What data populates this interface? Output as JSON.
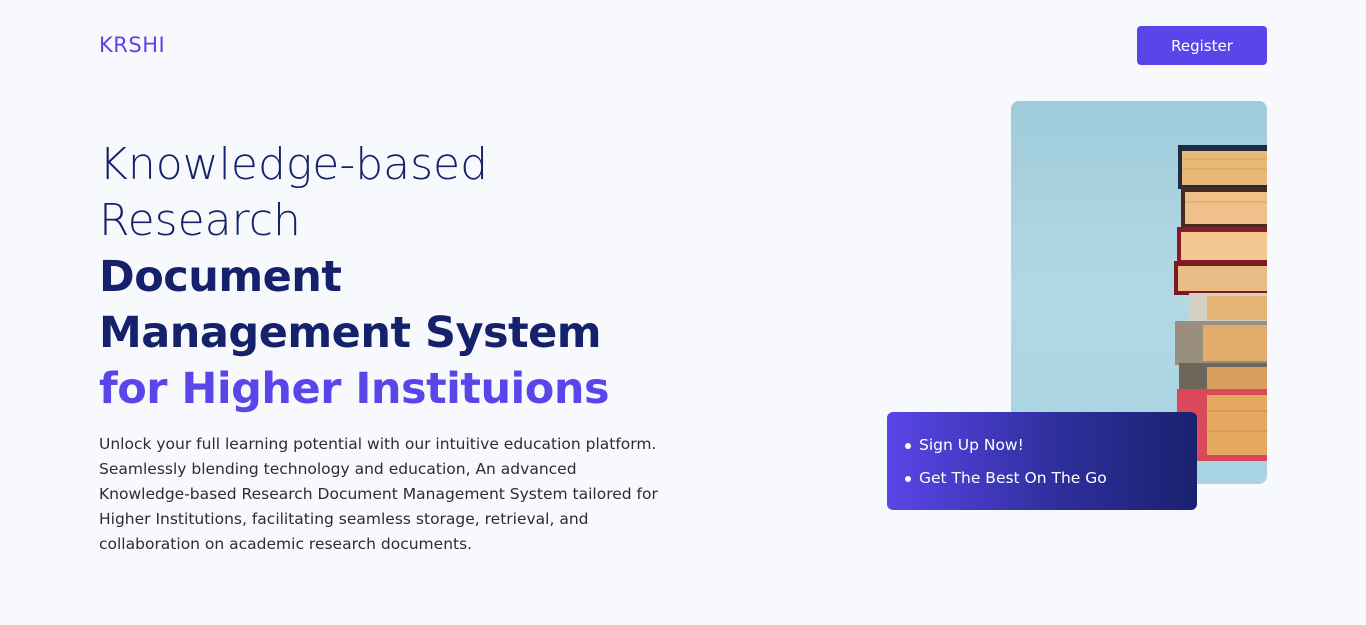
{
  "header": {
    "logo_text": "KRSHI",
    "register_label": "Register"
  },
  "hero": {
    "title_line1": "Knowledge-based",
    "title_line2": "Research",
    "title_line3": "Document",
    "title_line4": "Management System",
    "title_line5": "for Higher Instituions",
    "description": "Unlock your full learning potential with our intuitive education platform. Seamlessly blending technology and education, An advanced Knowledge-based Research Document Management System tailored for Higher Institutions, facilitating seamless storage, retrieval, and collaboration on academic research documents."
  },
  "info_card": {
    "items": [
      {
        "label": "Sign Up Now!"
      },
      {
        "label": "Get The Best On The Go"
      }
    ]
  },
  "colors": {
    "accent": "#5b45ea",
    "title_navy": "#15226b",
    "background": "#f8f9fc"
  }
}
